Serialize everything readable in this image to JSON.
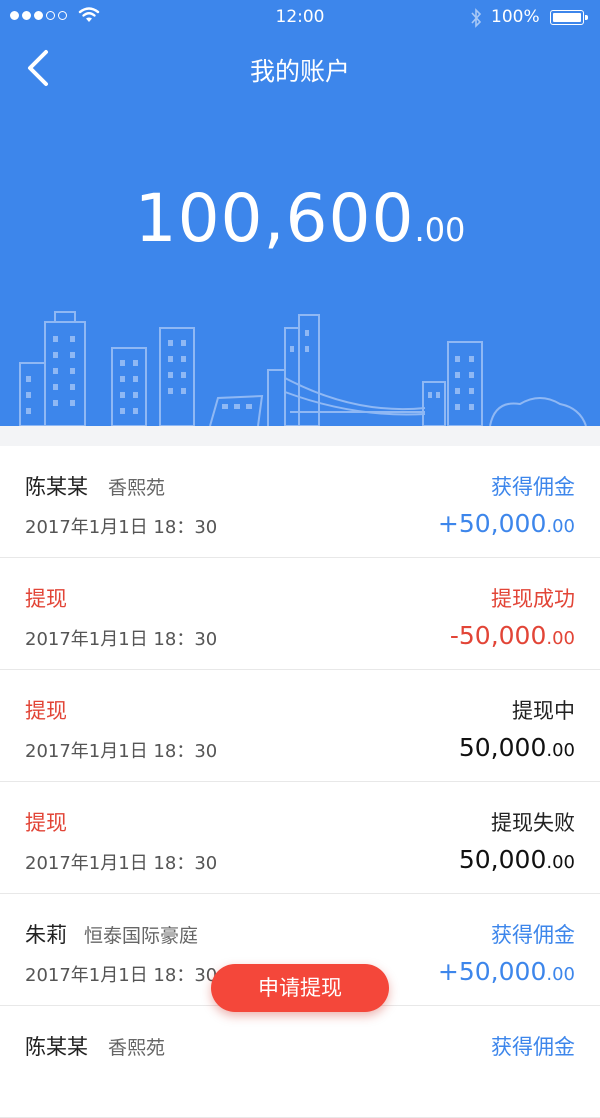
{
  "status_bar": {
    "time": "12:00",
    "battery": "100%"
  },
  "nav": {
    "title": "我的账户"
  },
  "balance": {
    "int": "100,600",
    "dec": ".00"
  },
  "records": [
    {
      "name": "陈某某",
      "sub": "香熙苑",
      "date": "2017年1月1日 18：30",
      "status": "获得佣金",
      "amount_int": "+50,000",
      "amount_dec": ".00",
      "name_color": "dark",
      "status_color": "blue",
      "amount_color": "blue"
    },
    {
      "name": "提现",
      "sub": "",
      "date": "2017年1月1日 18：30",
      "status": "提现成功",
      "amount_int": "-50,000",
      "amount_dec": ".00",
      "name_color": "red",
      "status_color": "red",
      "amount_color": "red"
    },
    {
      "name": "提现",
      "sub": "",
      "date": "2017年1月1日 18：30",
      "status": "提现中",
      "amount_int": "50,000",
      "amount_dec": ".00",
      "name_color": "red",
      "status_color": "dark",
      "amount_color": "dark"
    },
    {
      "name": "提现",
      "sub": "",
      "date": "2017年1月1日 18：30",
      "status": "提现失败",
      "amount_int": "50,000",
      "amount_dec": ".00",
      "name_color": "red",
      "status_color": "dark",
      "amount_color": "dark"
    },
    {
      "name": "朱莉",
      "sub": "恒泰国际豪庭",
      "date": "2017年1月1日 18：30",
      "status": "获得佣金",
      "amount_int": "+50,000",
      "amount_dec": ".00",
      "name_color": "dark",
      "status_color": "blue",
      "amount_color": "blue"
    },
    {
      "name": "陈某某",
      "sub": "香熙苑",
      "date": "",
      "status": "获得佣金",
      "amount_int": "",
      "amount_dec": "",
      "name_color": "dark",
      "status_color": "blue",
      "amount_color": "blue"
    }
  ],
  "withdraw_button": {
    "label": "申请提现"
  },
  "colors": {
    "primary": "#3d86eb",
    "danger": "#e24537",
    "button": "#f4473a"
  }
}
